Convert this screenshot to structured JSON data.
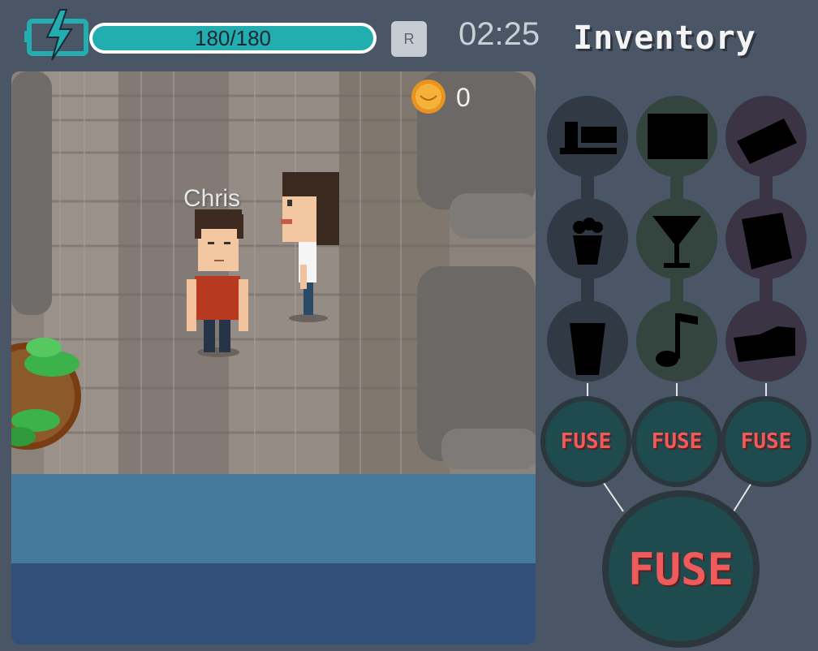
{
  "hud": {
    "energy_text": "180/180",
    "energy_fraction": 1.0,
    "reset_label": "R",
    "timer": "02:25",
    "inventory_title": "Inventory"
  },
  "scene": {
    "coin_count": "0",
    "npc_name": "Chris"
  },
  "inventory": {
    "columns": [
      {
        "color": "#313944",
        "items": [
          "food-tray-icon",
          "popcorn-icon",
          "cup-icon"
        ]
      },
      {
        "color": "#34443f",
        "items": [
          "monitor-icon",
          "cocktail-glass-icon",
          "music-note-icon"
        ]
      },
      {
        "color": "#3a3444",
        "items": [
          "card-icon",
          "paper-icon",
          "shoe-icon"
        ]
      }
    ],
    "fuse_labels": [
      "FUSE",
      "FUSE",
      "FUSE"
    ],
    "fuse_main_label": "FUSE"
  },
  "colors": {
    "accent": "#22adb0",
    "fuse_text": "#ef5b5b",
    "fuse_bg": "#1f4a4e",
    "background": "#4a5566"
  }
}
